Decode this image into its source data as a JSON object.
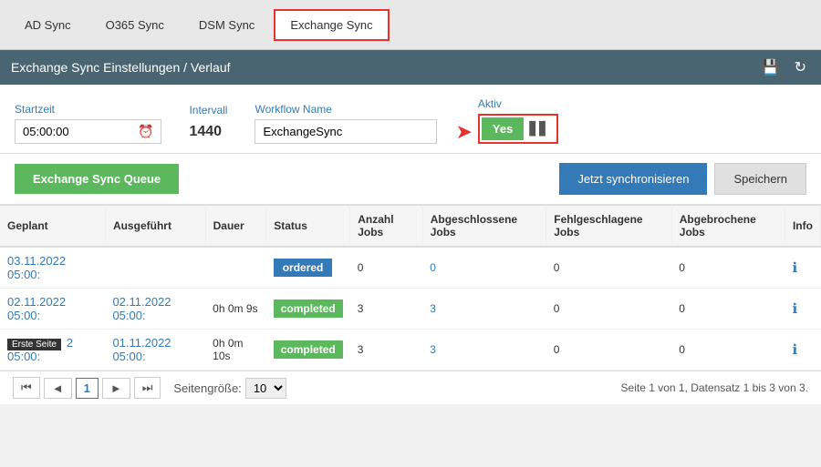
{
  "tabs": [
    {
      "id": "ad-sync",
      "label": "AD Sync",
      "active": false
    },
    {
      "id": "o365-sync",
      "label": "O365 Sync",
      "active": false
    },
    {
      "id": "dsm-sync",
      "label": "DSM Sync",
      "active": false
    },
    {
      "id": "exchange-sync",
      "label": "Exchange Sync",
      "active": true
    }
  ],
  "header": {
    "title": "Exchange Sync Einstellungen / Verlauf"
  },
  "form": {
    "startzeit_label": "Startzeit",
    "startzeit_value": "05:00:00",
    "intervall_label": "Intervall",
    "intervall_value": "1440",
    "workflow_label": "Workflow Name",
    "workflow_value": "ExchangeSync",
    "aktiv_label": "Aktiv",
    "yes_label": "Yes"
  },
  "buttons": {
    "queue": "Exchange Sync Queue",
    "sync_now": "Jetzt synchronisieren",
    "save": "Speichern"
  },
  "table": {
    "columns": [
      "Geplant",
      "Ausgeführt",
      "Dauer",
      "Status",
      "Anzahl Jobs",
      "Abgeschlossene Jobs",
      "Fehlgeschlagene Jobs",
      "Abgebrochene Jobs",
      "Info"
    ],
    "rows": [
      {
        "geplant": "03.11.2022 05:00:",
        "ausgefuehrt": "",
        "dauer": "",
        "status": "ordered",
        "status_type": "ordered",
        "anzahl_jobs": "0",
        "abgeschlossen": "0",
        "fehlgeschlagen": "0",
        "abgebrochen": "0",
        "erste_seite": false
      },
      {
        "geplant": "02.11.2022 05:00:",
        "ausgefuehrt": "02.11.2022 05:00:",
        "dauer": "0h 0m 9s",
        "status": "completed",
        "status_type": "completed",
        "anzahl_jobs": "3",
        "abgeschlossen": "3",
        "fehlgeschlagen": "0",
        "abgebrochen": "0",
        "erste_seite": false
      },
      {
        "geplant": "2 05:00:",
        "ausgefuehrt": "01.11.2022 05:00:",
        "dauer": "0h 0m 10s",
        "status": "completed",
        "status_type": "completed",
        "anzahl_jobs": "3",
        "abgeschlossen": "3",
        "fehlgeschlagen": "0",
        "abgebrochen": "0",
        "erste_seite": true
      }
    ]
  },
  "pagination": {
    "first_page_label": "◄◄",
    "prev_label": "◄",
    "next_label": "►",
    "last_label": "►►",
    "current_page": "1",
    "page_size_label": "Seitengröße:",
    "page_size_value": "10",
    "info": "Seite 1 von 1, Datensatz 1 bis 3 von 3."
  }
}
